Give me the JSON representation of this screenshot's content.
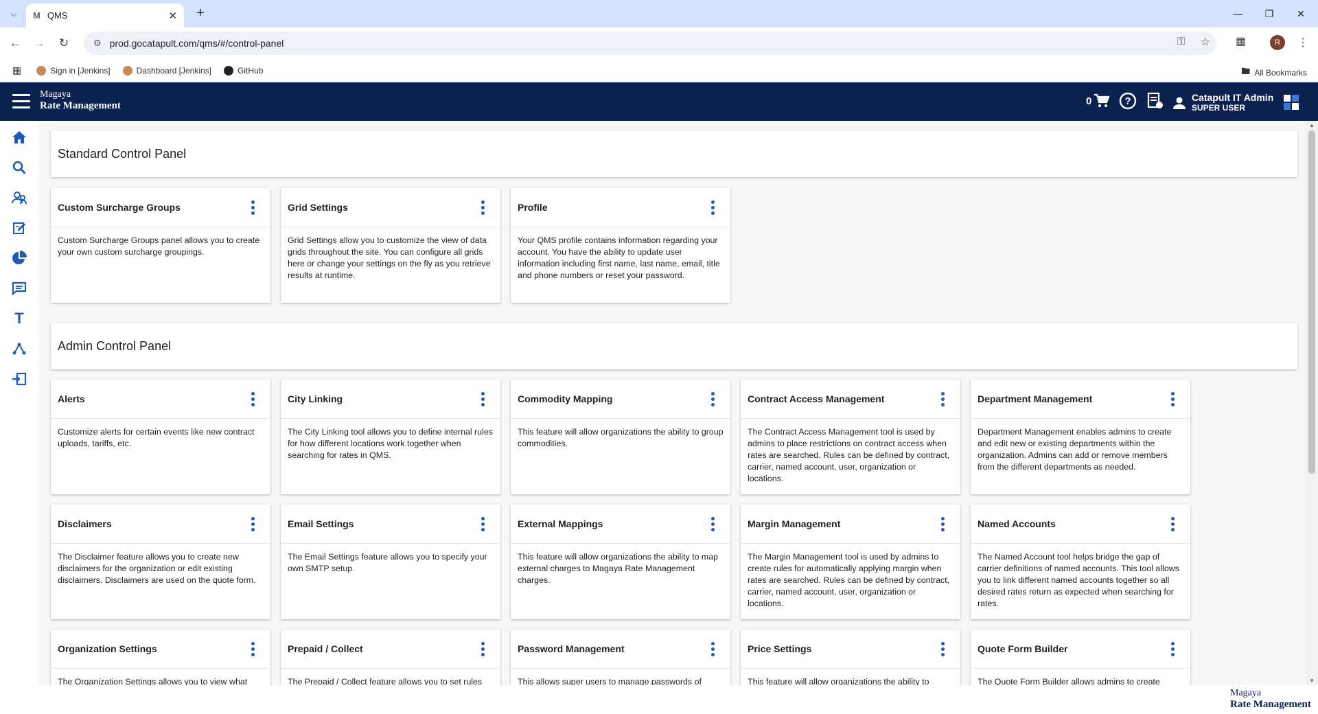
{
  "browser": {
    "tab_title": "QMS",
    "tab_favicon": "M",
    "url": "prod.gocatapult.com/qms/#/control-panel",
    "profile_initial": "R",
    "bookmarks": [
      "Sign in [Jenkins]",
      "Dashboard [Jenkins]",
      "GitHub"
    ],
    "all_bookmarks": "All Bookmarks"
  },
  "header": {
    "brand_line1": "Magaya",
    "brand_line2": "Rate Management",
    "cart_count": "0",
    "user_name": "Catapult IT Admin",
    "user_role": "SUPER USER",
    "bg_color": "#0b2150"
  },
  "rail": {
    "icons": [
      "home-icon",
      "search-icon",
      "users-icon",
      "edit-icon",
      "pie-chart-icon",
      "chat-icon",
      "text-icon",
      "network-icon",
      "logout-icon"
    ],
    "color": "#1f5bb5"
  },
  "standard": {
    "title": "Standard Control Panel",
    "cards": [
      {
        "title": "Custom Surcharge Groups",
        "desc": "Custom Surcharge Groups panel allows you to create your own custom surcharge groupings."
      },
      {
        "title": "Grid Settings",
        "desc": "Grid Settings allow you to customize the view of data grids throughout the site. You can configure all grids here or change your settings on the fly as you retrieve results at runtime."
      },
      {
        "title": "Profile",
        "desc": "Your QMS profile contains information regarding your account. You have the ability to update user information including first name, last name, email, title and phone numbers or reset your password."
      }
    ]
  },
  "admin": {
    "title": "Admin Control Panel",
    "cards": [
      {
        "title": "Alerts",
        "desc": "Customize alerts for certain events like new contract uploads, tariffs, etc."
      },
      {
        "title": "City Linking",
        "desc": "The City Linking tool allows you to define internal rules for how different locations work together when searching for rates in QMS."
      },
      {
        "title": "Commodity Mapping",
        "desc": "This feature will allow organizations the ability to group commodities."
      },
      {
        "title": "Contract Access Management",
        "desc": "The Contract Access Management tool is used by admins to place restrictions on contract access when rates are searched. Rules can be defined by contract, carrier, named account, user, organization or locations."
      },
      {
        "title": "Department Management",
        "desc": "Department Management enables admins to create and edit new or existing departments within the organization. Admins can add or remove members from the different departments as needed."
      },
      {
        "title": "Disclaimers",
        "desc": "The Disclaimer feature allows you to create new disclaimers for the organization or edit existing disclaimers. Disclaimers are used on the quote form."
      },
      {
        "title": "Email Settings",
        "desc": "The Email Settings feature allows you to specify your own SMTP setup."
      },
      {
        "title": "External Mappings",
        "desc": "This feature will allow organizations the ability to map external charges to Magaya Rate Management charges."
      },
      {
        "title": "Margin Management",
        "desc": "The Margin Management tool is used by admins to create rules for automatically applying margin when rates are searched. Rules can be defined by contract, carrier, named account, user, organization or locations."
      },
      {
        "title": "Named Accounts",
        "desc": "The Named Account tool helps bridge the gap of carrier definitions of named accounts. This tool allows you to link different named accounts together so all desired rates return as expected when searching for rates."
      },
      {
        "title": "Organization Settings",
        "desc": "The Organization Settings allows you to view what"
      },
      {
        "title": "Prepaid / Collect",
        "desc": "The Prepaid / Collect feature allows you to set rules"
      },
      {
        "title": "Password Management",
        "desc": "This allows super users to manage passwords of"
      },
      {
        "title": "Price Settings",
        "desc": "This feature will allow organizations the ability to"
      },
      {
        "title": "Quote Form Builder",
        "desc": "The Quote Form Builder allows admins to create"
      }
    ]
  },
  "footer": {
    "brand_line1": "Magaya",
    "brand_line2": "Rate Management"
  }
}
